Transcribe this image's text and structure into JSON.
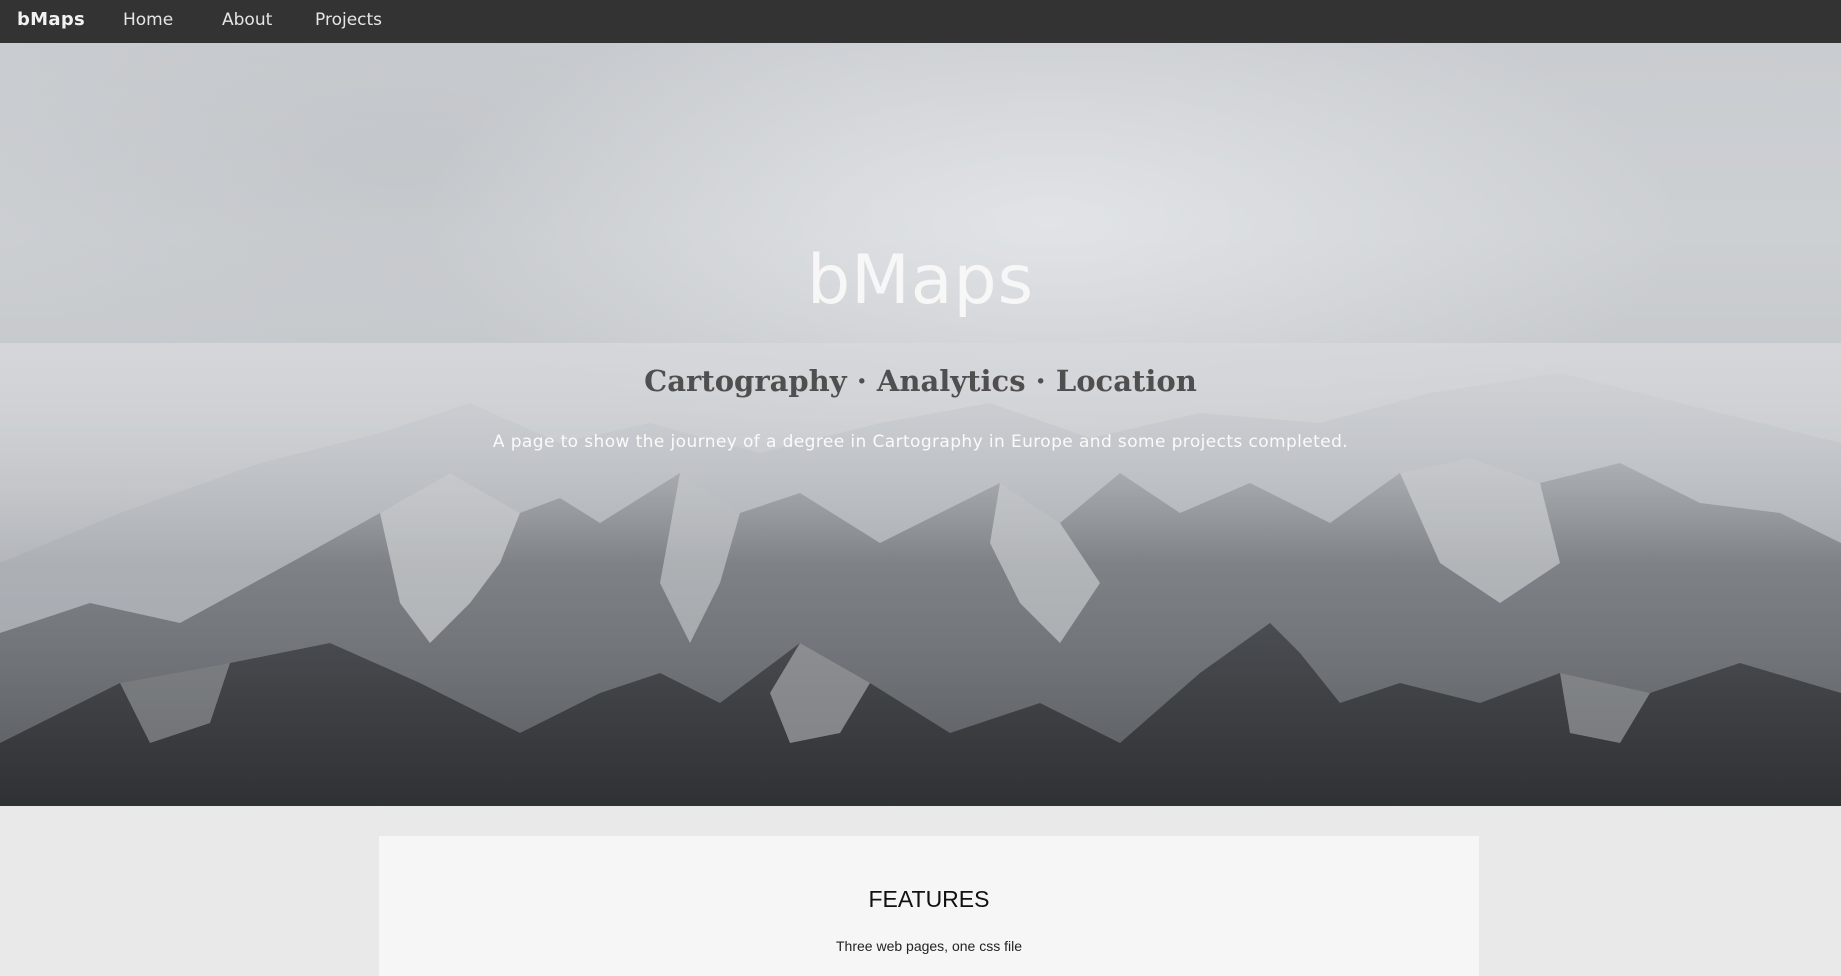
{
  "navbar": {
    "brand": "bMaps",
    "links": [
      {
        "label": "Home"
      },
      {
        "label": "About"
      },
      {
        "label": "Projects"
      }
    ]
  },
  "hero": {
    "title": "bMaps",
    "subtitle": "Cartography · Analytics · Location",
    "description": "A page to show the journey of a degree in Cartography in Europe and some projects completed."
  },
  "features": {
    "heading": "FEATURES",
    "text": "Three web pages, one css file"
  },
  "colors": {
    "navbar_bg": "#333333",
    "page_bg": "#e9e9e9",
    "card_bg": "#f6f6f6",
    "subtitle": "#4f4f4f"
  }
}
